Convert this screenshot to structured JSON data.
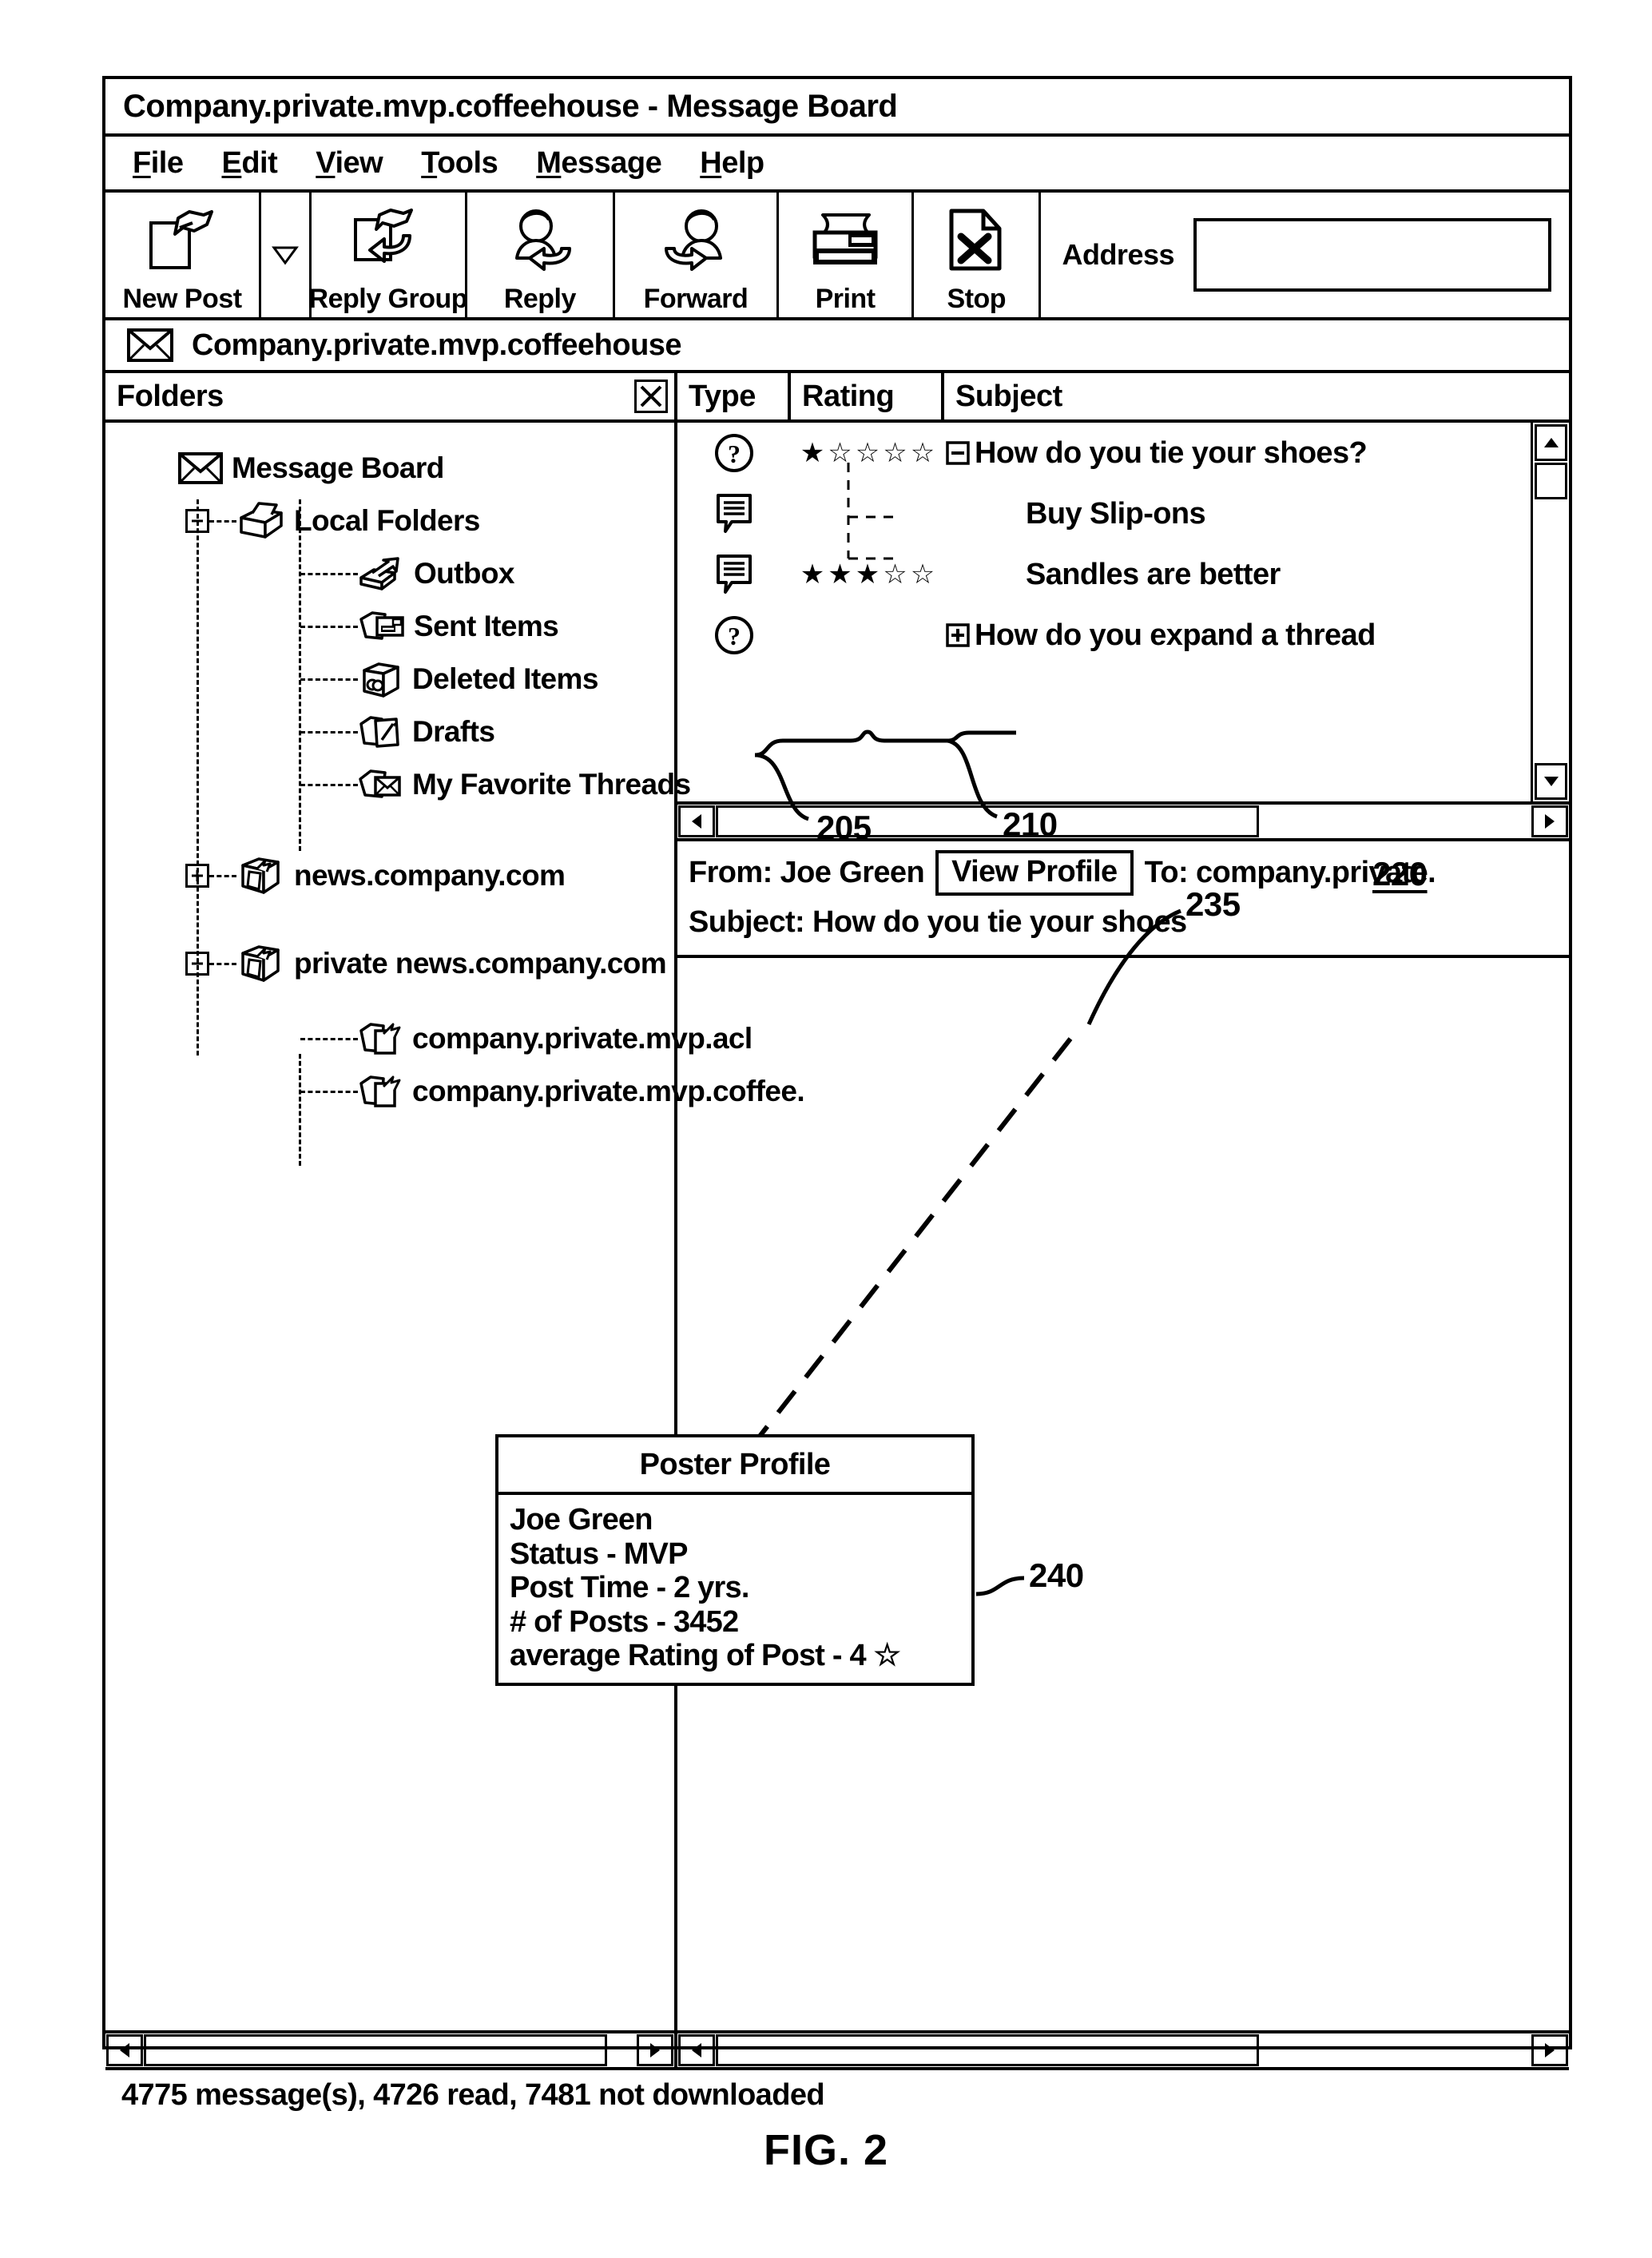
{
  "window": {
    "title": "Company.private.mvp.coffeehouse - Message Board"
  },
  "menu": {
    "items": [
      {
        "mnemonic": "F",
        "rest": "ile"
      },
      {
        "mnemonic": "E",
        "rest": "dit"
      },
      {
        "mnemonic": "V",
        "rest": "iew"
      },
      {
        "mnemonic": "T",
        "rest": "ools"
      },
      {
        "mnemonic": "M",
        "rest": "essage"
      },
      {
        "mnemonic": "H",
        "rest": "elp"
      }
    ]
  },
  "toolbar": {
    "buttons": [
      {
        "label": "New Post",
        "icon": "new-post-icon"
      },
      {
        "label": "Reply Group",
        "icon": "reply-group-icon"
      },
      {
        "label": "Reply",
        "icon": "reply-icon"
      },
      {
        "label": "Forward",
        "icon": "forward-icon"
      },
      {
        "label": "Print",
        "icon": "print-icon"
      },
      {
        "label": "Stop",
        "icon": "stop-icon"
      }
    ],
    "dropdown_icon": "chevron-down-icon",
    "address_label": "Address",
    "address_value": "",
    "address_placeholder": ""
  },
  "group_bar": {
    "icon": "envelope-icon",
    "text": "Company.private.mvp.coffeehouse"
  },
  "columns": {
    "folders": "Folders",
    "type": "Type",
    "rating": "Rating",
    "subject": "Subject",
    "close_icon": "close-x-icon"
  },
  "folder_tree": {
    "items": [
      {
        "label": "Message Board",
        "icon": "envelope-icon",
        "toggle": "none",
        "depth": 0
      },
      {
        "label": "Local Folders",
        "icon": "open-box-icon",
        "toggle": "minus",
        "depth": 0
      },
      {
        "label": "Outbox",
        "icon": "outbox-icon",
        "toggle": "none",
        "depth": 1
      },
      {
        "label": "Sent Items",
        "icon": "sent-items-icon",
        "toggle": "none",
        "depth": 1
      },
      {
        "label": "Deleted Items",
        "icon": "trash-box-icon",
        "toggle": "none",
        "depth": 1
      },
      {
        "label": "Drafts",
        "icon": "drafts-icon",
        "toggle": "none",
        "depth": 1
      },
      {
        "label": "My Favorite Threads",
        "icon": "favorite-mail-icon",
        "toggle": "none",
        "depth": 1
      },
      {
        "label": "news.company.com",
        "icon": "news-server-icon",
        "toggle": "plus",
        "depth": 0
      },
      {
        "label": "private news.company.com",
        "icon": "news-server-icon",
        "toggle": "minus",
        "depth": 0
      },
      {
        "label": "company.private.mvp.acl",
        "icon": "newsgroup-icon",
        "toggle": "none",
        "depth": 1
      },
      {
        "label": "company.private.mvp.coffee.",
        "icon": "newsgroup-icon",
        "toggle": "none",
        "depth": 1
      }
    ]
  },
  "message_list": {
    "rows": [
      {
        "type_icon": "question-mark-icon",
        "rating": 1,
        "max_rating": 5,
        "subject": "How do you tie your shoes?",
        "toggle": "minus",
        "indent": 0
      },
      {
        "type_icon": "comment-icon",
        "rating": 0,
        "max_rating": 5,
        "subject": "Buy Slip-ons",
        "toggle": "none",
        "indent": 1
      },
      {
        "type_icon": "comment-icon",
        "rating": 3,
        "max_rating": 5,
        "subject": "Sandles are better",
        "toggle": "none",
        "indent": 1
      },
      {
        "type_icon": "question-mark-icon",
        "rating": 0,
        "max_rating": 5,
        "subject": "How do you expand a thread",
        "toggle": "plus",
        "indent": 0
      }
    ],
    "filled_star": "★",
    "empty_star": "☆"
  },
  "message_header": {
    "from_label": "From: Joe Green",
    "view_profile_button": "View Profile",
    "to_label": "To: company.private.",
    "subject_label": "Subject: How do you tie your shoes"
  },
  "poster_profile": {
    "title": "Poster Profile",
    "lines": [
      "Joe Green",
      "Status - MVP",
      "Post Time - 2 yrs.",
      "# of Posts - 3452",
      "average Rating of Post - 4 ☆"
    ]
  },
  "status_bar": {
    "text": "4775 message(s), 4726 read, 7481 not downloaded"
  },
  "callouts": {
    "c205": "205",
    "c210": "210",
    "c220": "220",
    "c235": "235",
    "c240": "240"
  },
  "figure": {
    "label": "FIG. 2"
  }
}
